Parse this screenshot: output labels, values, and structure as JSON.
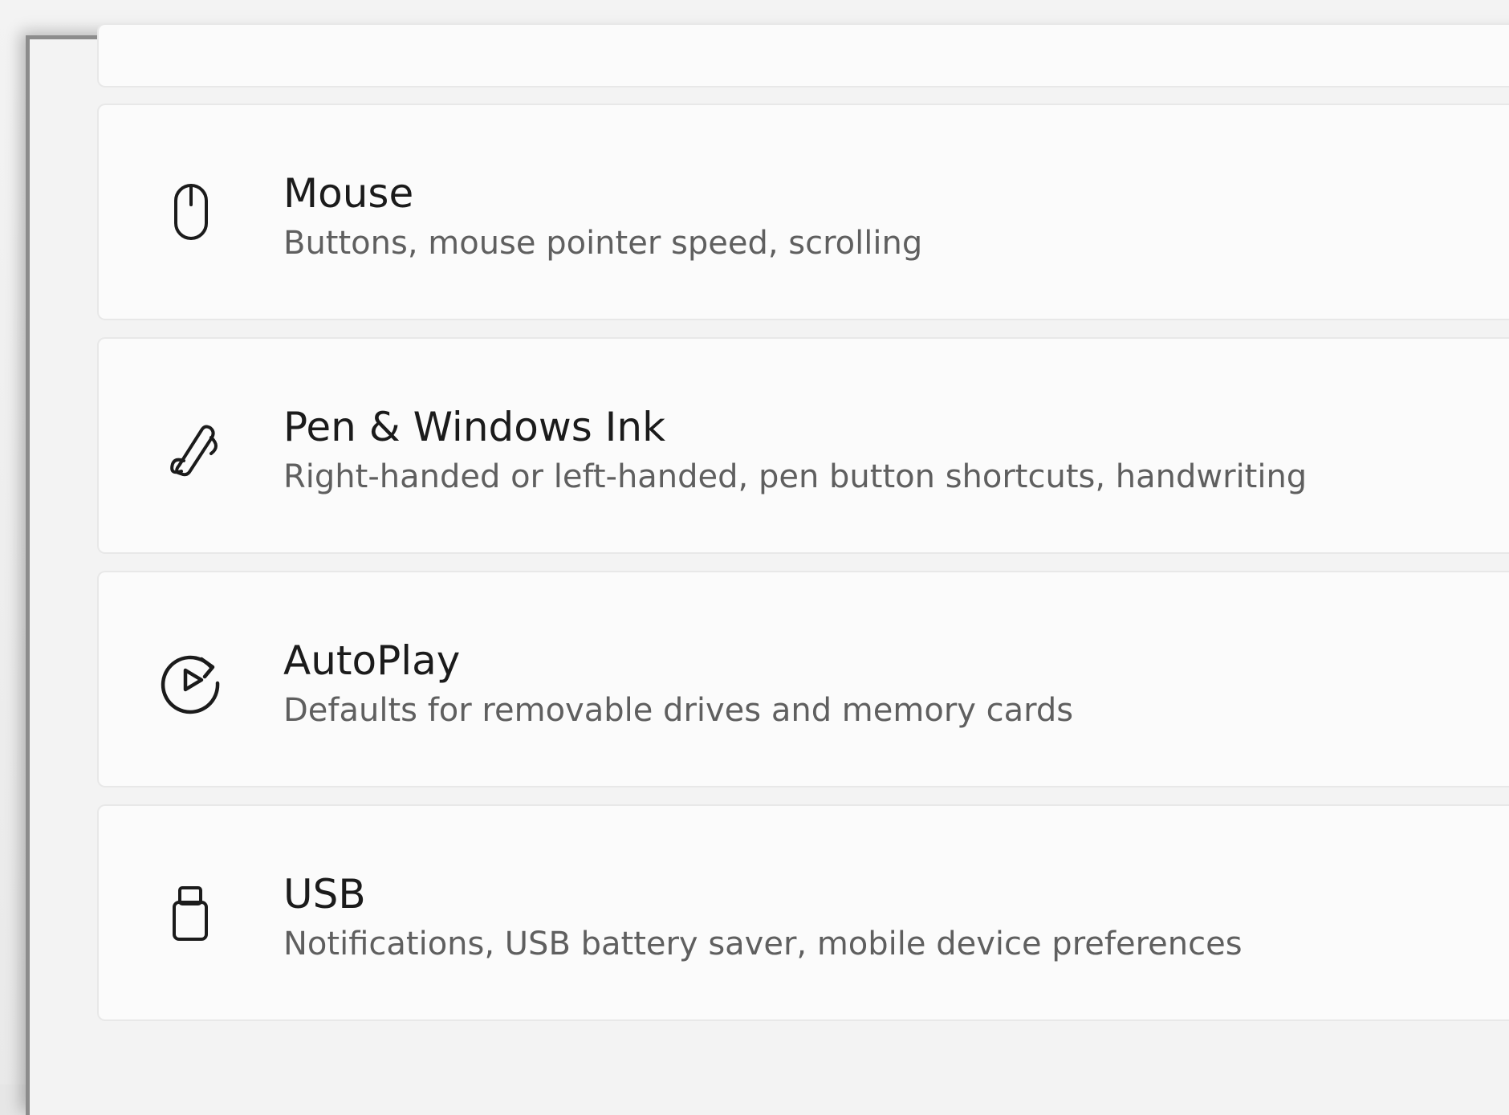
{
  "settings": {
    "items": [
      {
        "title": "Mouse",
        "description": "Buttons, mouse pointer speed, scrolling",
        "icon": "mouse-icon"
      },
      {
        "title": "Pen & Windows Ink",
        "description": "Right-handed or left-handed, pen button shortcuts, handwriting",
        "icon": "pen-icon"
      },
      {
        "title": "AutoPlay",
        "description": "Defaults for removable drives and memory cards",
        "icon": "autoplay-icon"
      },
      {
        "title": "USB",
        "description": "Notifications, USB battery saver, mobile device preferences",
        "icon": "usb-icon"
      }
    ]
  },
  "colors": {
    "background": "#f3f3f3",
    "card": "#fbfbfb",
    "title_text": "#1b1b1b",
    "description_text": "#5f5f5f"
  }
}
